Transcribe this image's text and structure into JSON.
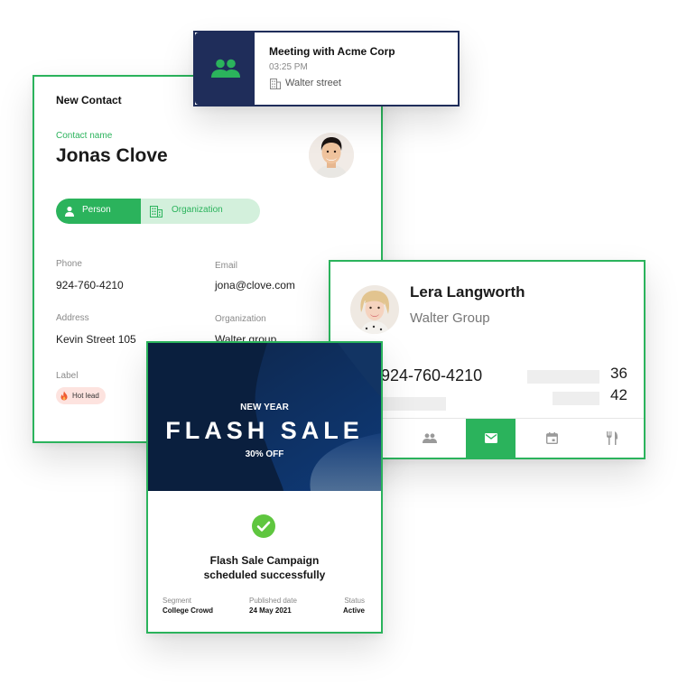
{
  "colors": {
    "accent": "#2bb35c",
    "navy": "#1f2d5a",
    "pill_bg": "#d3f0dc",
    "hot_lead_bg": "#fde3df"
  },
  "contact": {
    "header": "New Contact",
    "name_label": "Contact name",
    "name": "Jonas Clove",
    "segments": {
      "person": "Person",
      "organization": "Organization",
      "selected": "Person"
    },
    "fields": {
      "phone_label": "Phone",
      "phone": "924-760-4210",
      "email_label": "Email",
      "email": "jona@clove.com",
      "address_label": "Address",
      "address": "Kevin Street 105",
      "organization_label": "Organization",
      "organization": "Walter group",
      "label_label": "Label",
      "label_value": "Hot lead"
    }
  },
  "meeting": {
    "title": "Meeting with Acme Corp",
    "time": "03:25 PM",
    "location": "Walter street",
    "icon": "people-icon"
  },
  "lera": {
    "name": "Lera Langworth",
    "company": "Walter Group",
    "phone": "924-760-4210",
    "num_1": "36",
    "num_2": "42",
    "tabs": [
      "people-icon",
      "mail-icon",
      "calendar-icon",
      "restaurant-icon"
    ],
    "active_tab": "mail-icon"
  },
  "flash": {
    "kicker": "NEW YEAR",
    "headline": "FLASH SALE",
    "discount": "30% OFF",
    "success_line1": "Flash Sale Campaign",
    "success_line2": "scheduled successfully",
    "segment_label": "Segment",
    "segment": "College Crowd",
    "published_label": "Published date",
    "published": "24 May 2021",
    "status_label": "Status",
    "status": "Active"
  }
}
